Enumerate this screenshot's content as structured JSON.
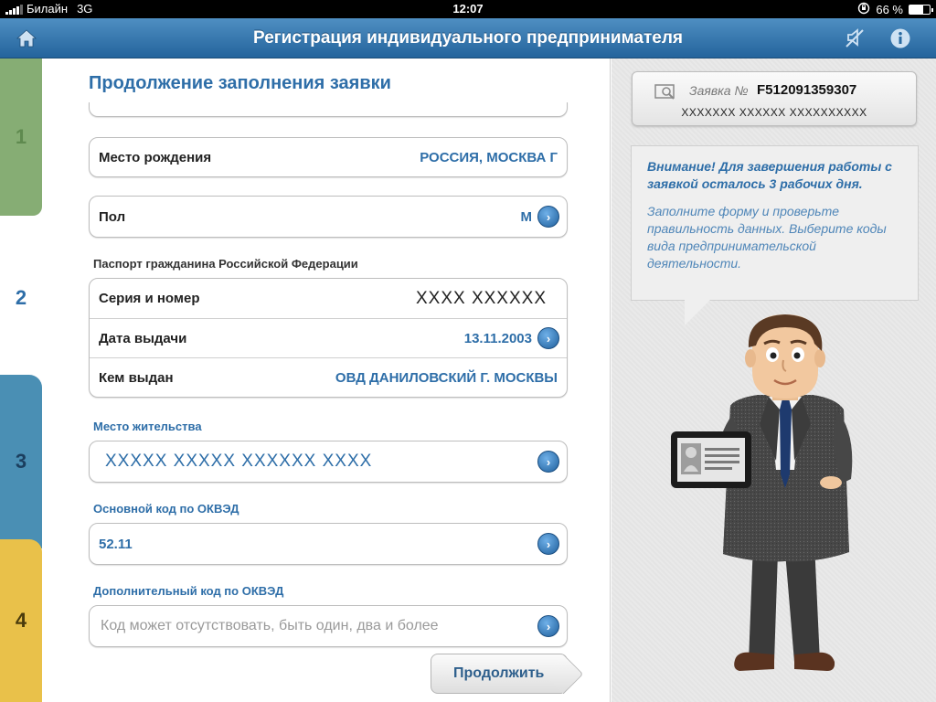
{
  "status_bar": {
    "carrier": "Билайн",
    "network": "3G",
    "time": "12:07",
    "battery": "66 %",
    "battery_level": 0.66
  },
  "nav": {
    "title": "Регистрация индивидуального предпринимателя",
    "home_icon": "home-icon",
    "mute_icon": "mute-icon",
    "info_icon": "info-icon"
  },
  "tabs": [
    {
      "label": "1",
      "color": "#86ad74"
    },
    {
      "label": "2",
      "color": "#ffffff"
    },
    {
      "label": "3",
      "color": "#4a8fb4"
    },
    {
      "label": "4",
      "color": "#e9c14a"
    }
  ],
  "form": {
    "title": "Продолжение заполнения заявки",
    "birthplace": {
      "label": "Место рождения",
      "value": "РОССИЯ, МОСКВА Г"
    },
    "gender": {
      "label": "Пол",
      "value": "М"
    },
    "passport": {
      "section": "Паспорт гражданина Российской Федерации",
      "series": {
        "label": "Серия и номер",
        "value": "XXXX XXXXXX"
      },
      "issue_date": {
        "label": "Дата выдачи",
        "value": "13.11.2003"
      },
      "issued_by": {
        "label": "Кем выдан",
        "value": "ОВД ДАНИЛОВСКИЙ Г. МОСКВЫ"
      }
    },
    "residence": {
      "section": "Место жительства",
      "value": "XXXXX XXXXX XXXXXX XXXX"
    },
    "okved_main": {
      "section": "Основной код по ОКВЭД",
      "value": "52.11"
    },
    "okved_extra": {
      "section": "Дополнительный код по ОКВЭД",
      "placeholder": "Код может отсутствовать, быть один, два и более"
    },
    "continue_label": "Продолжить"
  },
  "side": {
    "application_label": "Заявка №",
    "application_number": "F512091359307",
    "application_sub": "XXXXXXX XXXXXX XXXXXXXXXX",
    "warning": "Внимание! Для завершения работы с заявкой осталось 3 рабочих дня.",
    "info": "Заполните форму и проверьте правильность данных. Выберите коды вида предпринимательской деятельности."
  },
  "colors": {
    "accent": "#2e6ea8",
    "nav_top": "#4f8fc2",
    "nav_bottom": "#24649c"
  }
}
